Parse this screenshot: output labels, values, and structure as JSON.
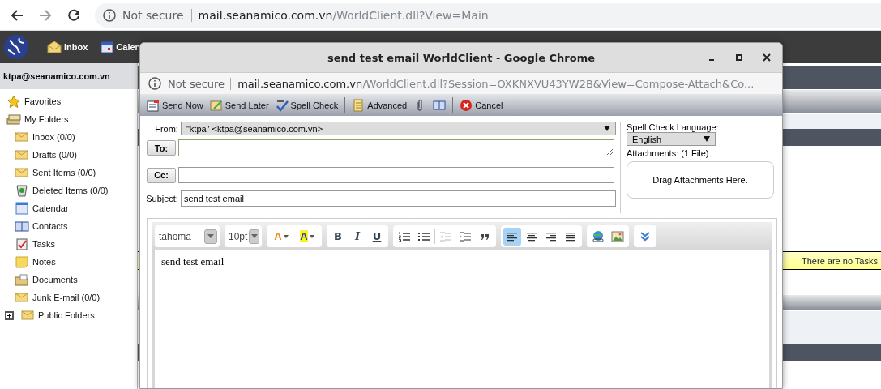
{
  "browser": {
    "security": "Not secure",
    "host": "mail.seanamico.com.vn",
    "path": "/WorldClient.dll?View=Main"
  },
  "nav": [
    {
      "kind": "inbox",
      "label": "Inbox"
    },
    {
      "kind": "calendar",
      "label": "Calen"
    }
  ],
  "sidebar": {
    "account": "ktpa@seanamico.com.vn",
    "tree": [
      {
        "kind": "star",
        "label": "Favorites"
      },
      {
        "kind": "folders",
        "label": "My Folders",
        "children": [
          {
            "kind": "mail",
            "label": "Inbox (0/0)"
          },
          {
            "kind": "mail",
            "label": "Drafts (0/0)"
          },
          {
            "kind": "mail",
            "label": "Sent Items (0/0)"
          },
          {
            "kind": "trash",
            "label": "Deleted Items (0/0)"
          },
          {
            "kind": "calendar",
            "label": "Calendar"
          },
          {
            "kind": "contacts",
            "label": "Contacts"
          },
          {
            "kind": "tasks",
            "label": "Tasks"
          },
          {
            "kind": "notes",
            "label": "Notes"
          },
          {
            "kind": "documents",
            "label": "Documents"
          },
          {
            "kind": "mail",
            "label": "Junk E-mail (0/0)"
          }
        ]
      },
      {
        "kind": "mail",
        "label": "Public Folders",
        "expanded": false
      }
    ]
  },
  "tasks_notice": "There are no Tasks",
  "compose": {
    "title": "send test email WorldClient - Google Chrome",
    "security": "Not secure",
    "host": "mail.seanamico.com.vn",
    "path": "/WorldClient.dll?Session=OXKNXVU43YW2B&View=Compose-Attach&Co...",
    "toolbar": [
      [
        {
          "kind": "send_now",
          "label": "Send Now"
        },
        {
          "kind": "send_later",
          "label": "Send Later"
        },
        {
          "kind": "spell",
          "label": "Spell Check"
        }
      ],
      [
        {
          "kind": "advanced",
          "label": "Advanced"
        },
        {
          "kind": "attach"
        },
        {
          "kind": "book"
        }
      ],
      [
        {
          "kind": "cancel",
          "label": "Cancel"
        }
      ]
    ],
    "from": {
      "label": "From:",
      "value": "\"ktpa\" <ktpa@seanamico.com.vn>"
    },
    "to": {
      "label": "To:"
    },
    "cc": {
      "label": "Cc:"
    },
    "subject": {
      "label": "Subject:",
      "value": "send test email"
    },
    "spell_label": "Spell Check Language:",
    "language": "English",
    "attachments": "Attachments: (1 File)",
    "drop": "Drag Attachments Here.",
    "editor": {
      "font": "tahoma",
      "size": "10pt",
      "colors": [
        {
          "kind": "text",
          "label": "A"
        },
        {
          "kind": "background",
          "label": "A"
        }
      ],
      "format": [
        {
          "kind": "bold",
          "label": "B"
        },
        {
          "kind": "italic",
          "label": "I"
        },
        {
          "kind": "underline",
          "label": "U"
        }
      ],
      "lists": [
        {
          "kind": "ol",
          "disabled": false
        },
        {
          "kind": "ul",
          "disabled": false
        },
        {
          "kind": "outdent",
          "disabled": true
        },
        {
          "kind": "indent",
          "disabled": false
        },
        {
          "kind": "quote",
          "disabled": false
        }
      ],
      "align": [
        {
          "kind": "left",
          "selected": true
        },
        {
          "kind": "center",
          "selected": false
        },
        {
          "kind": "right",
          "selected": false
        },
        {
          "kind": "justify",
          "selected": false
        }
      ],
      "insert": [
        {
          "kind": "link"
        },
        {
          "kind": "image"
        }
      ],
      "body": "send test email"
    }
  }
}
